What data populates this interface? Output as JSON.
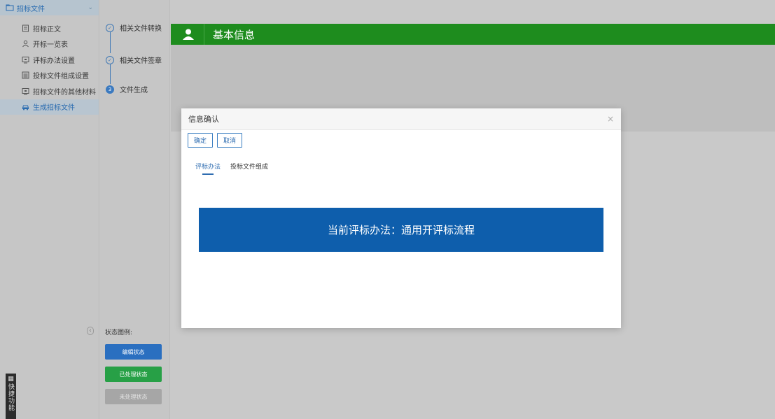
{
  "sidebar": {
    "header": "招标文件",
    "items": [
      {
        "label": "招标正文",
        "icon": "document-icon"
      },
      {
        "label": "开标一览表",
        "icon": "user-icon"
      },
      {
        "label": "评标办法设置",
        "icon": "monitor-icon"
      },
      {
        "label": "投标文件组成设置",
        "icon": "list-icon"
      },
      {
        "label": "招标文件的其他材料",
        "icon": "monitor-icon"
      },
      {
        "label": "生成招标文件",
        "icon": "car-icon",
        "active": true
      }
    ],
    "quick_label": "快捷功能"
  },
  "steps": {
    "items": [
      {
        "label": "相关文件转换",
        "state": "done"
      },
      {
        "label": "相关文件签章",
        "state": "done"
      },
      {
        "label": "文件生成",
        "state": "current",
        "number": "3"
      }
    ],
    "legend_title": "状态图例:",
    "legend": [
      {
        "label": "编辑状态",
        "color": "#2a6fc0"
      },
      {
        "label": "已处理状态",
        "color": "#27a046"
      },
      {
        "label": "未处理状态",
        "color": "#a6a6a6"
      }
    ]
  },
  "main": {
    "section_title": "基本信息"
  },
  "modal": {
    "title": "信息确认",
    "close": "×",
    "confirm_label": "确定",
    "cancel_label": "取消",
    "tabs": [
      {
        "label": "评标办法",
        "active": true
      },
      {
        "label": "投标文件组成",
        "active": false
      }
    ],
    "banner": "当前评标办法：通用开评标流程"
  },
  "colors": {
    "accent_green": "#1e8c1e",
    "banner_blue": "#0e5eac",
    "link_blue": "#2f6db1"
  }
}
